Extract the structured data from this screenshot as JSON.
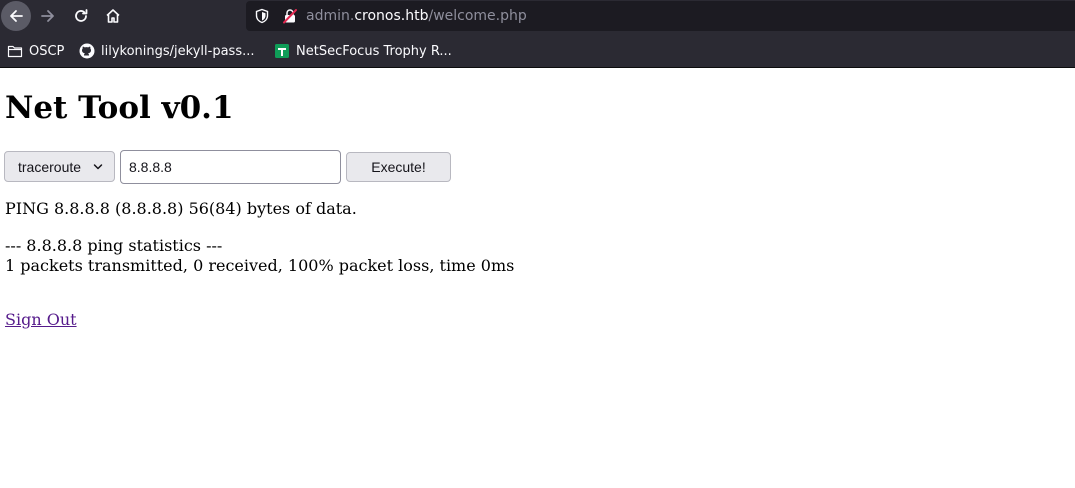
{
  "browser": {
    "url": {
      "prefix": "admin.",
      "host": "cronos.htb",
      "path": "/welcome.php"
    },
    "bookmarks": [
      {
        "label": "OSCP",
        "icon": "folder-icon"
      },
      {
        "label": "lilykonings/jekyll-pass...",
        "icon": "github-icon"
      },
      {
        "label": "NetSecFocus Trophy R...",
        "icon": "spreadsheet-icon"
      }
    ],
    "colors": {
      "chrome": "#2b2a33",
      "urlbar": "#1c1b22",
      "text": "#fbfbfe"
    }
  },
  "page": {
    "title": "Net Tool v0.1",
    "form": {
      "command_selected": "traceroute",
      "host_value": "8.8.8.8",
      "execute_label": "Execute!"
    },
    "output": {
      "line1": "PING 8.8.8.8 (8.8.8.8) 56(84) bytes of data.",
      "line2": "--- 8.8.8.8 ping statistics ---",
      "line3": "1 packets transmitted, 0 received, 100% packet loss, time 0ms"
    },
    "signout_label": "Sign Out",
    "colors": {
      "link_visited": "#551a8b"
    }
  }
}
